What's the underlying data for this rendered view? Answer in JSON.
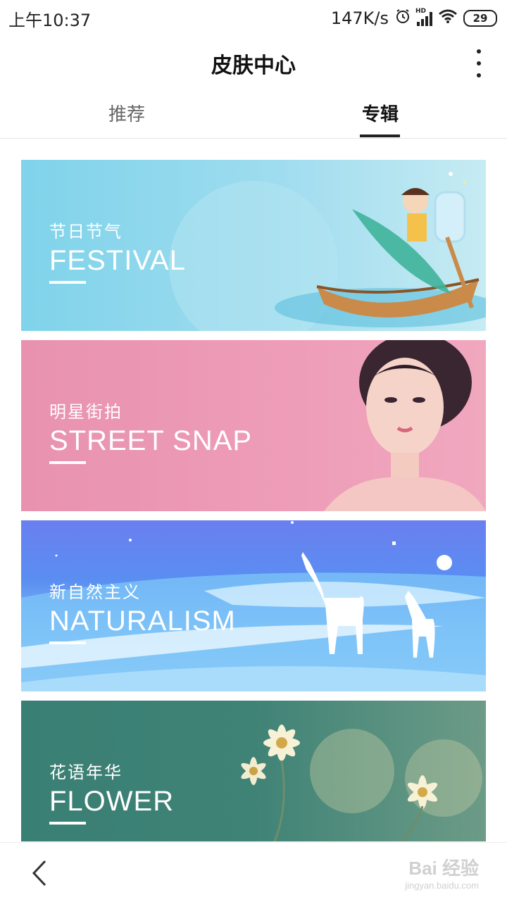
{
  "status": {
    "time": "上午10:37",
    "speed": "147K/s",
    "hd": "HD",
    "battery": "29"
  },
  "header": {
    "title": "皮肤中心"
  },
  "tabs": [
    {
      "label": "推荐",
      "active": false
    },
    {
      "label": "专辑",
      "active": true
    }
  ],
  "banners": [
    {
      "cn": "节日节气",
      "en": "FESTIVAL"
    },
    {
      "cn": "明星街拍",
      "en": "STREET SNAP"
    },
    {
      "cn": "新自然主义",
      "en": "NATURALISM"
    },
    {
      "cn": "花语年华",
      "en": "FLOWER"
    }
  ],
  "watermark": {
    "main": "Bai 经验",
    "sub": "jingyan.baidu.com"
  },
  "icons": [
    "alarm-icon",
    "signal-icon",
    "wifi-icon",
    "battery-icon",
    "more-icon",
    "back-icon"
  ],
  "colors": {
    "festival": "#8fd8ec",
    "street_snap": "#ec98b4",
    "naturalism": "#6c8ff0",
    "flower": "#3d8175"
  }
}
